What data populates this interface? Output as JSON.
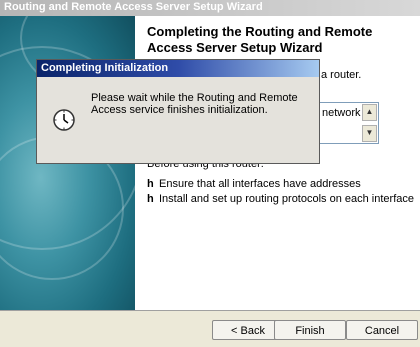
{
  "window": {
    "title": "Routing and Remote Access Server Setup Wizard"
  },
  "main": {
    "heading": "Completing the Routing and Remote Access Server Setup Wizard",
    "partial_text": "a router.",
    "list_item": "network",
    "before_text": "Before using this router:",
    "bullets": [
      {
        "marker": "h",
        "text": "Ensure that all interfaces have addresses"
      },
      {
        "marker": "h",
        "text": "Install and set up routing protocols on each interface"
      }
    ]
  },
  "buttons": {
    "back": "< Back",
    "finish": "Finish",
    "cancel": "Cancel"
  },
  "dialog": {
    "title": "Completing Initialization",
    "message": "Please wait while the Routing and Remote Access service finishes initialization.",
    "icon": "clock-icon"
  },
  "colors": {
    "dialog_title": "#0a246a",
    "panel": "#3e93a4"
  }
}
